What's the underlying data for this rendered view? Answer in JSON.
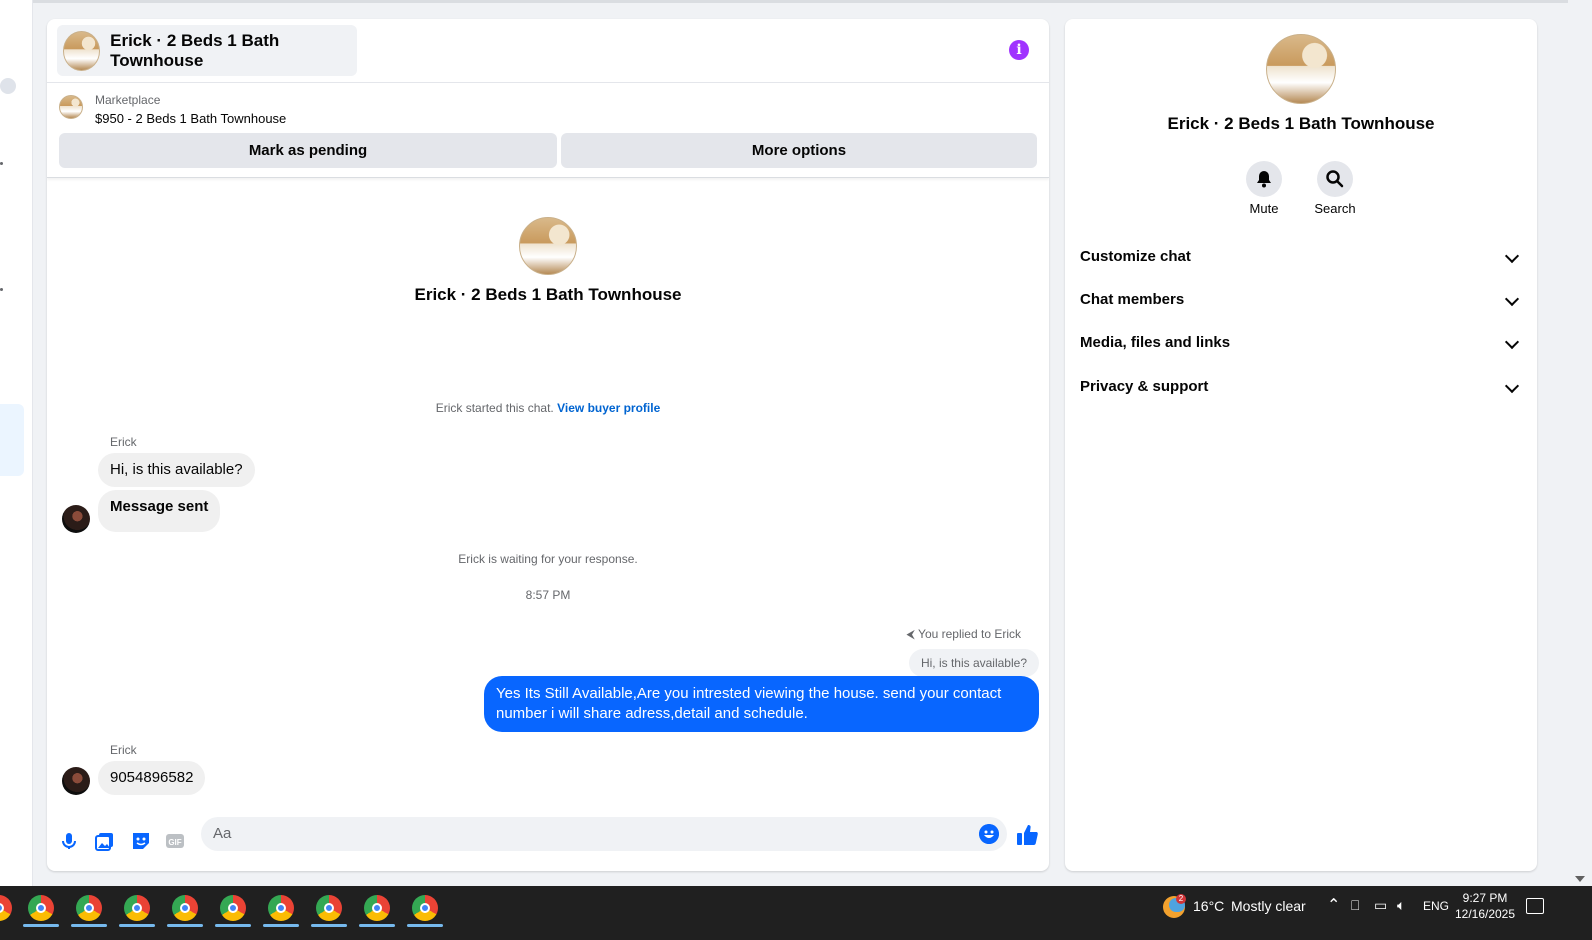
{
  "conversation": {
    "title": "Erick · 2 Beds 1 Bath Townhouse",
    "info_icon": "info-icon"
  },
  "listing": {
    "category": "Marketplace",
    "price_title": "$950 - 2 Beds 1 Bath Townhouse",
    "mark_pending_label": "Mark as pending",
    "more_options_label": "More options"
  },
  "intro": {
    "name": "Erick · 2 Beds 1 Bath Townhouse",
    "started_text": "Erick started this chat.",
    "view_profile_link": "View buyer profile"
  },
  "messages": {
    "incoming1_sender": "Erick",
    "incoming1_bubble1": "Hi, is this available?",
    "incoming1_bubble2": "Message sent",
    "waiting_text": "Erick is waiting for your response.",
    "timestamp": "8:57 PM",
    "reply_note": "You replied to Erick",
    "quoted_text": "Hi, is this available?",
    "outgoing_text": "Yes Its Still Available,Are you intrested viewing the house. send your contact number i will share adress,detail and schedule.",
    "incoming2_sender": "Erick",
    "incoming2_bubble": "9054896582"
  },
  "composer": {
    "placeholder": "Aa",
    "icons": [
      "microphone-icon",
      "photo-icon",
      "sticker-icon",
      "gif-icon",
      "emoji-icon",
      "like-icon"
    ]
  },
  "side_panel": {
    "name": "Erick · 2 Beds 1 Bath Townhouse",
    "mute_label": "Mute",
    "search_label": "Search",
    "sections": [
      "Customize chat",
      "Chat members",
      "Media, files and links",
      "Privacy & support"
    ]
  },
  "taskbar": {
    "weather_temp": "16°C",
    "weather_desc": "Mostly clear",
    "weather_badge": "2",
    "language": "ENG",
    "time": "9:27 PM",
    "date": "12/16/2025"
  },
  "colors": {
    "accent": "#0866ff",
    "info": "#a033ff",
    "link": "#0064d1"
  }
}
